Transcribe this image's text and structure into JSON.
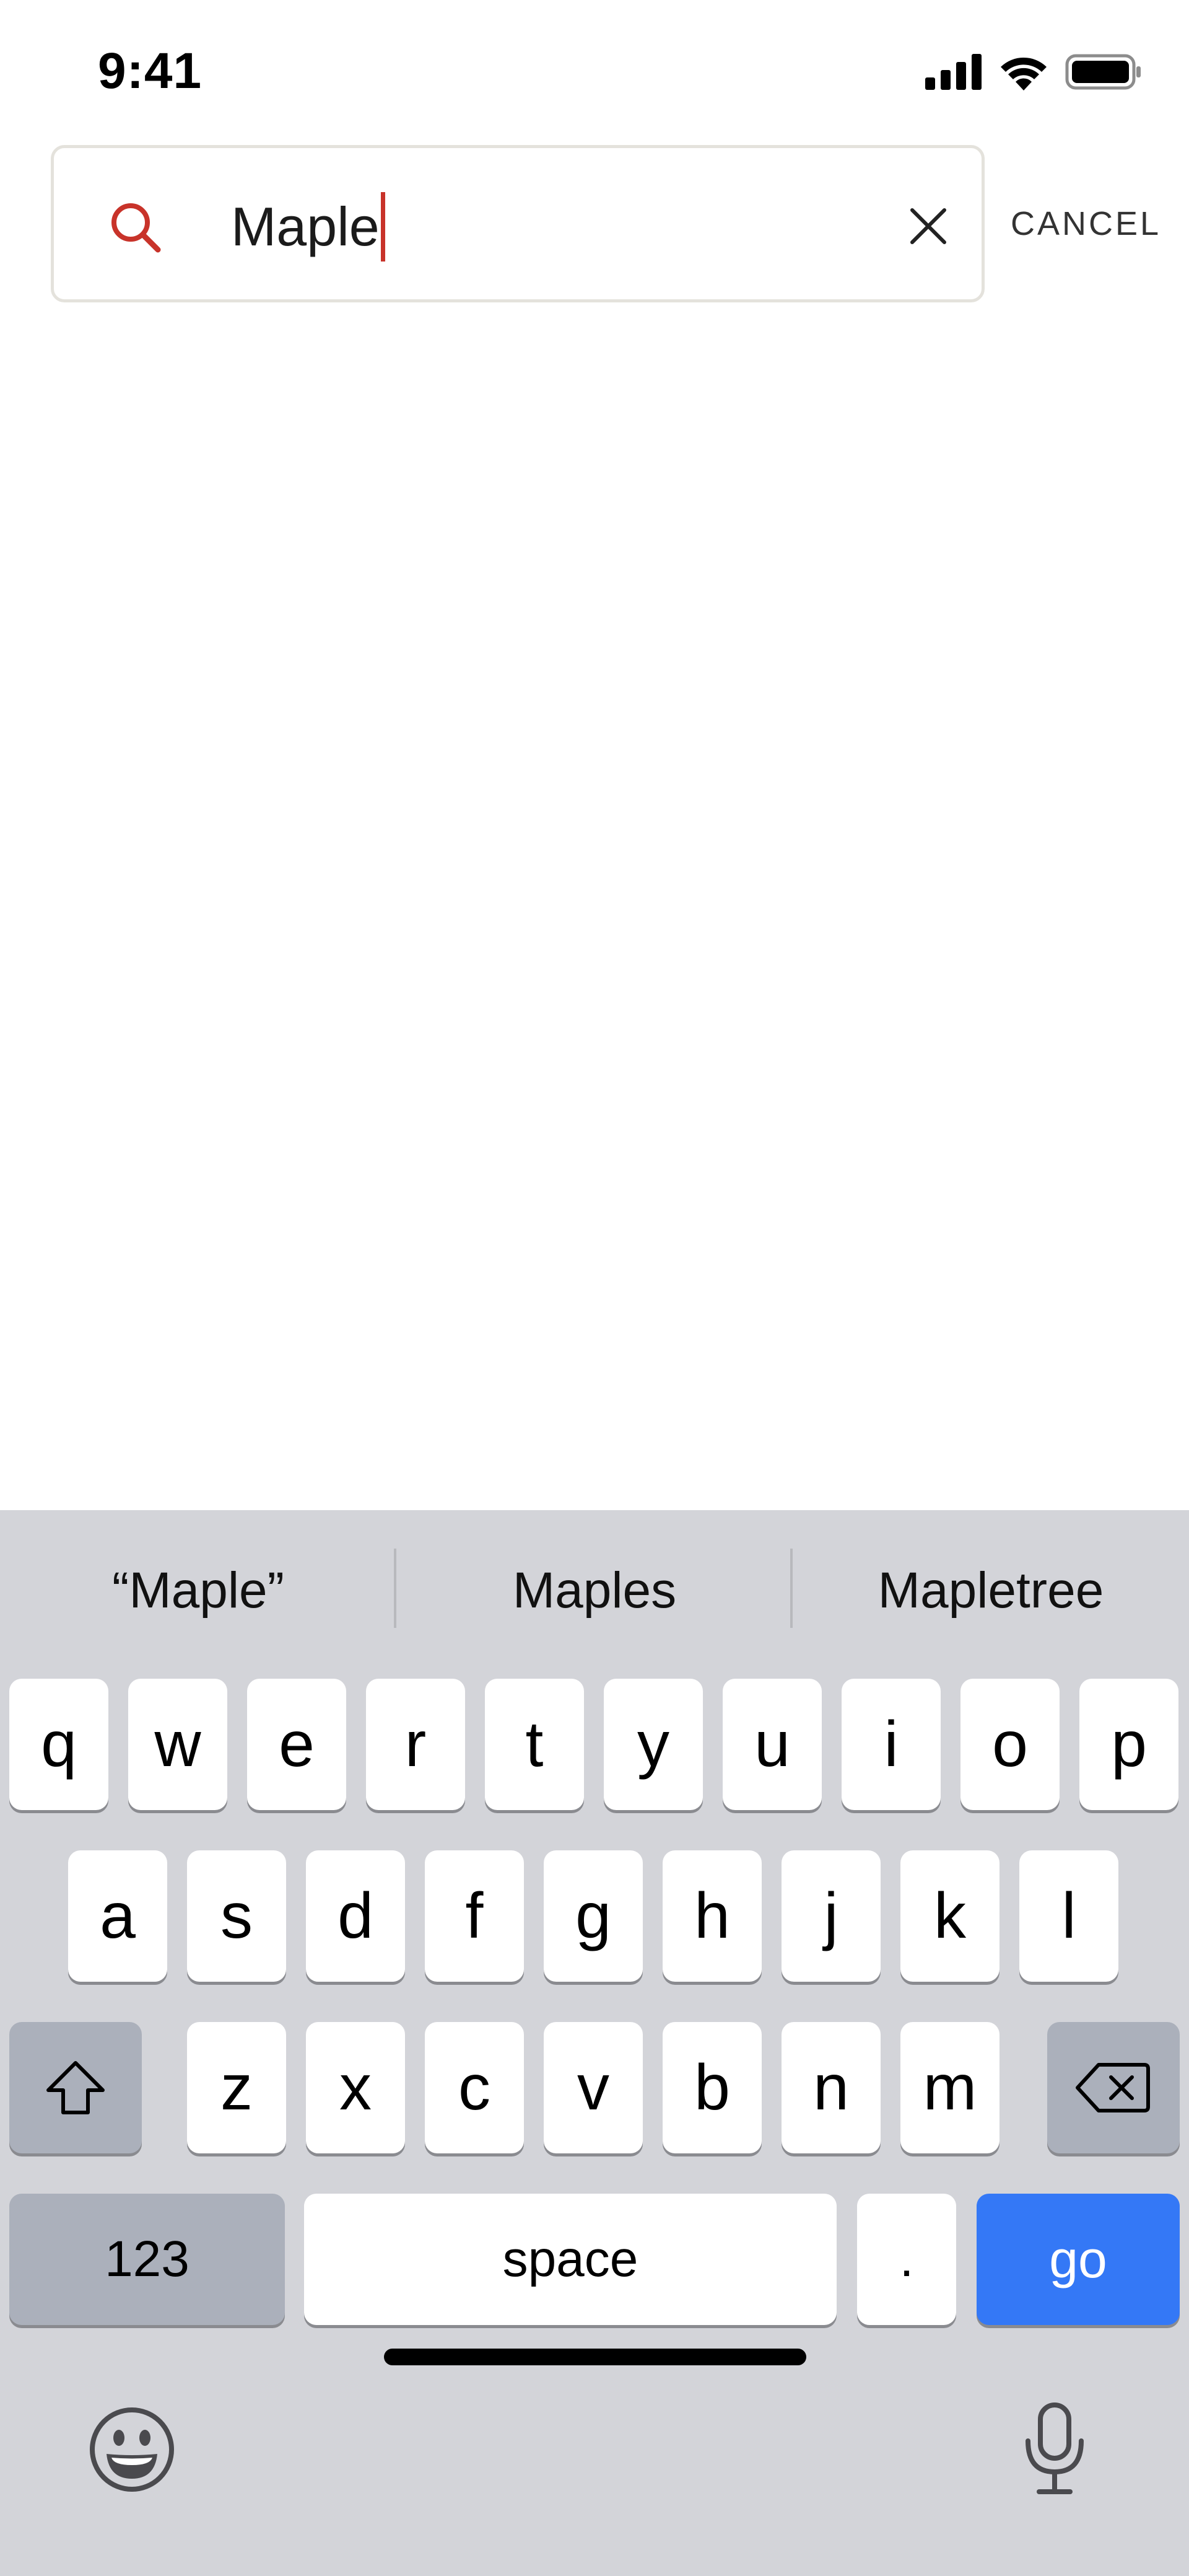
{
  "status_bar": {
    "time": "9:41",
    "icons": [
      "cellular-signal-icon",
      "wifi-icon",
      "battery-icon"
    ]
  },
  "search": {
    "value": "Maple",
    "search_icon": "search-icon",
    "clear_icon": "clear-icon",
    "cancel_label": "CANCEL"
  },
  "keyboard": {
    "suggestions": [
      "“Maple”",
      "Maples",
      "Mapletree"
    ],
    "row1": [
      "q",
      "w",
      "e",
      "r",
      "t",
      "y",
      "u",
      "i",
      "o",
      "p"
    ],
    "row2": [
      "a",
      "s",
      "d",
      "f",
      "g",
      "h",
      "j",
      "k",
      "l"
    ],
    "row3": [
      "z",
      "x",
      "c",
      "v",
      "b",
      "n",
      "m"
    ],
    "numbers_label": "123",
    "space_label": "space",
    "period_label": ".",
    "go_label": "go",
    "shift_icon": "shift-icon",
    "delete_icon": "delete-icon",
    "emoji_icon": "emoji-icon",
    "mic_icon": "microphone-icon"
  },
  "colors": {
    "accent": "#c8332a",
    "go_key": "#3478f6",
    "keyboard_bg": "#d3d4d9",
    "dark_key": "#abb0bb"
  }
}
